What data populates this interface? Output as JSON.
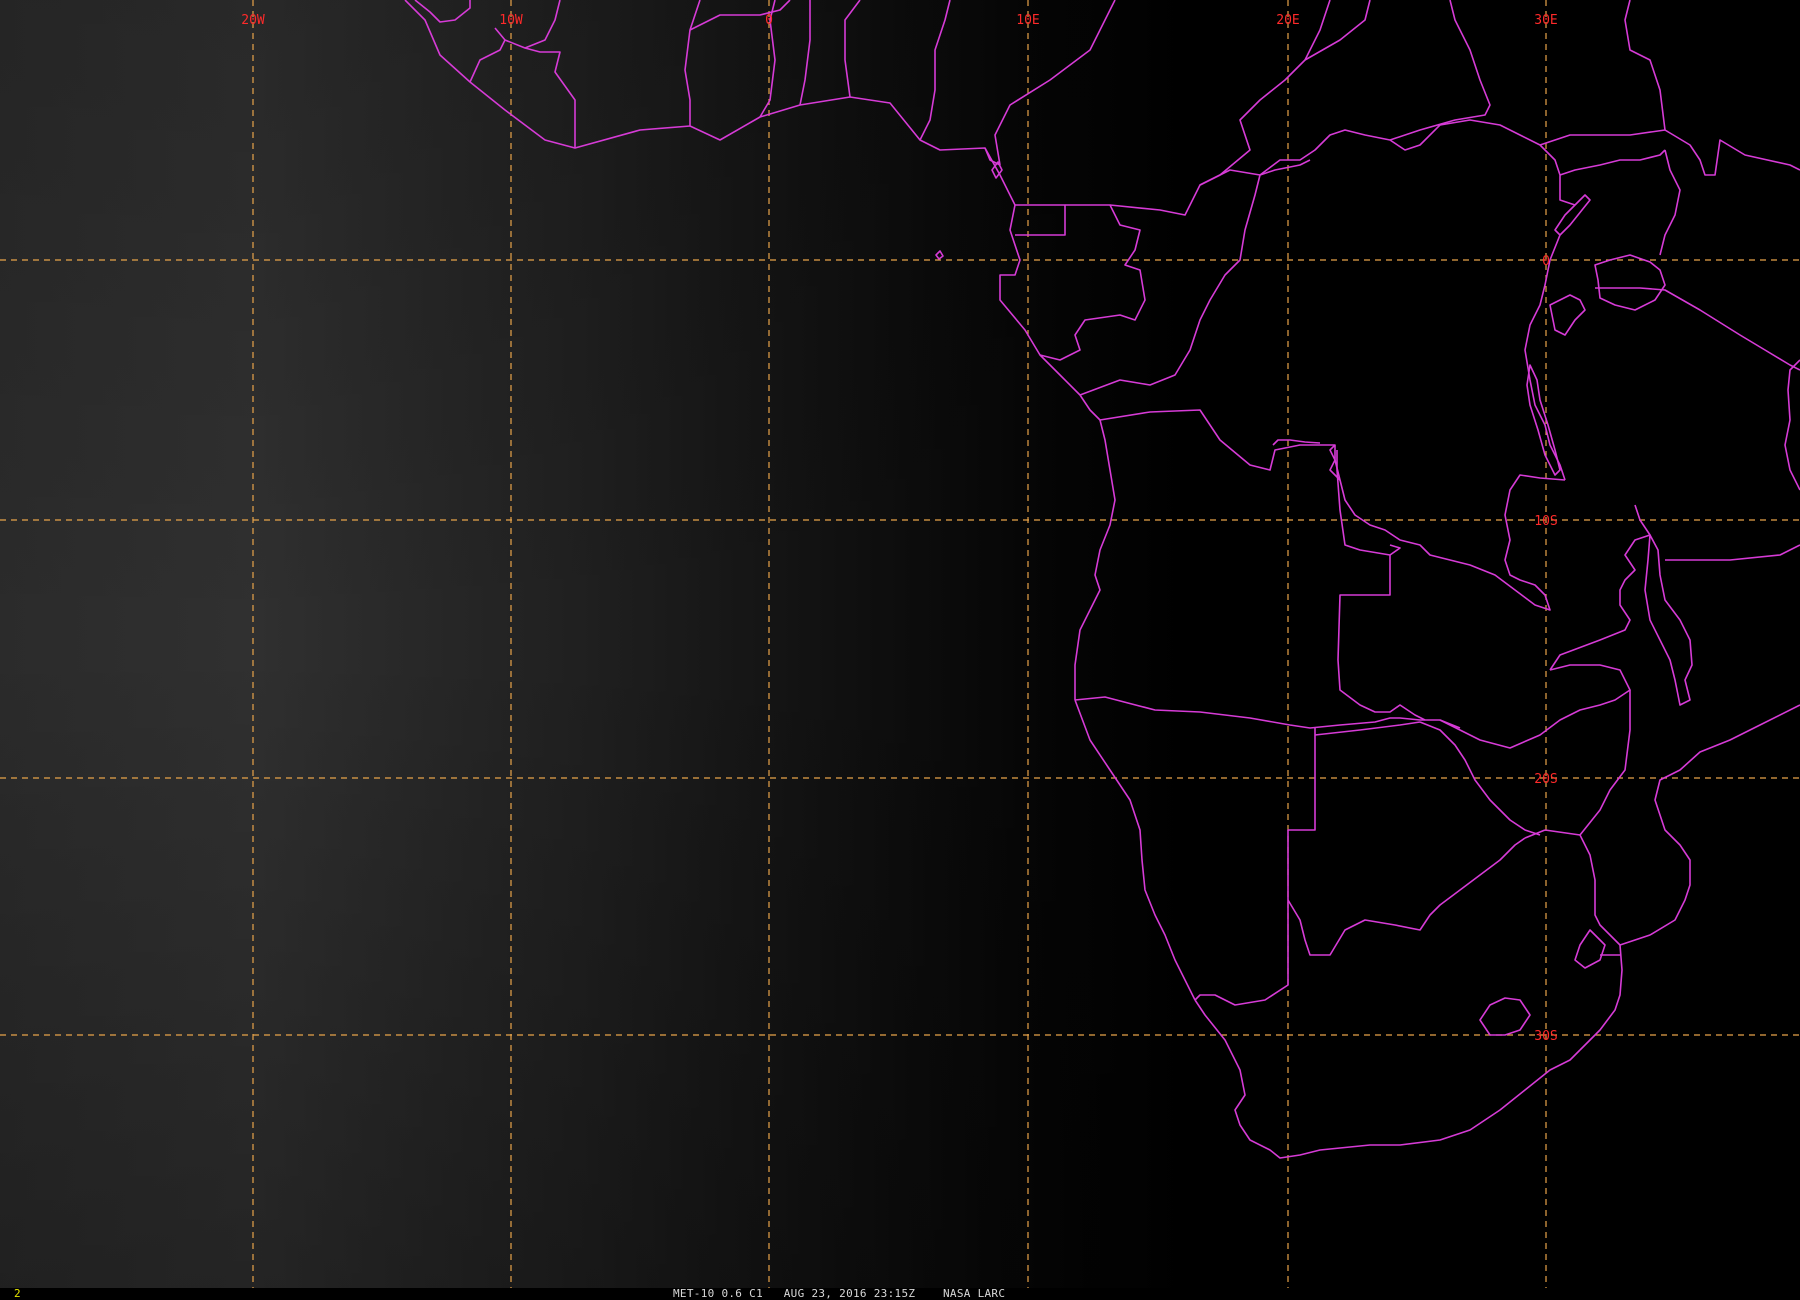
{
  "image": {
    "satellite": "MET-10",
    "channel": "0.6",
    "band_id": "C1",
    "date": "AUG 23, 2016",
    "time": "23:15Z",
    "producer": "NASA LARC",
    "frame_number": "2"
  },
  "status_bar": {
    "frame": "2",
    "caption": "MET-10 0.6 C1   AUG 23, 2016 23:15Z    NASA LARC"
  },
  "grid": {
    "longitude_labels": [
      "20W",
      "10W",
      "0",
      "10E",
      "20E",
      "30E"
    ],
    "latitude_labels": [
      "0",
      "10S",
      "20S",
      "30S"
    ]
  },
  "colors": {
    "background": "#000000",
    "borders": "#d63bd6",
    "graticule": "#e8a44a",
    "grid_labels": "#ff2a2a",
    "frame_number": "#e6e600",
    "caption": "#d8d8d8"
  }
}
